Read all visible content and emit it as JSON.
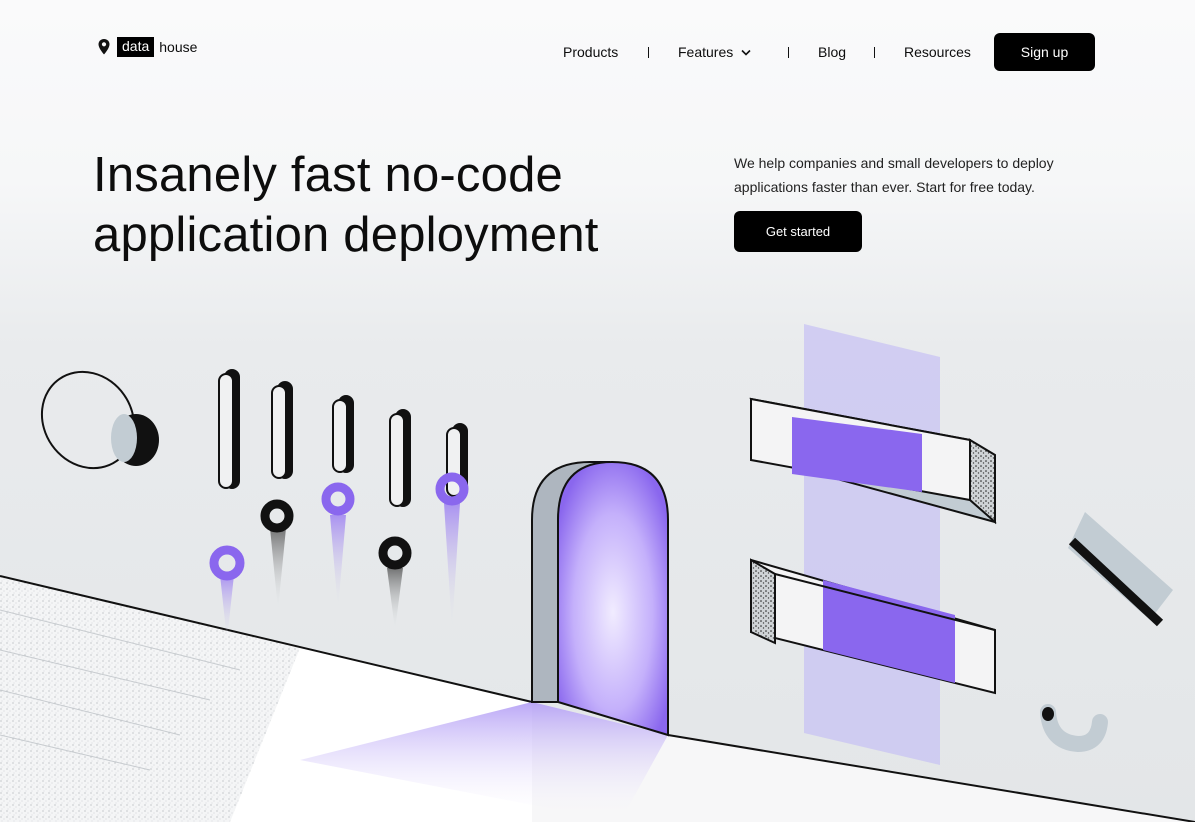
{
  "brand": {
    "box_text": "data",
    "word": "house",
    "icon": "location-pin-icon"
  },
  "nav": {
    "items": [
      "Products",
      "Features",
      "Blog",
      "Resources"
    ],
    "features_icon": "chevron-down-icon",
    "signup_label": "Sign up"
  },
  "hero": {
    "title_line1": "Insanely fast no-code",
    "title_line2": "application deployment",
    "description": "We help companies and small developers to deploy applications faster than ever. Start for free today.",
    "cta_label": "Get started"
  },
  "colors": {
    "accent": "#8a67ee",
    "dark": "#000000",
    "slate": "#c2ccd3"
  }
}
